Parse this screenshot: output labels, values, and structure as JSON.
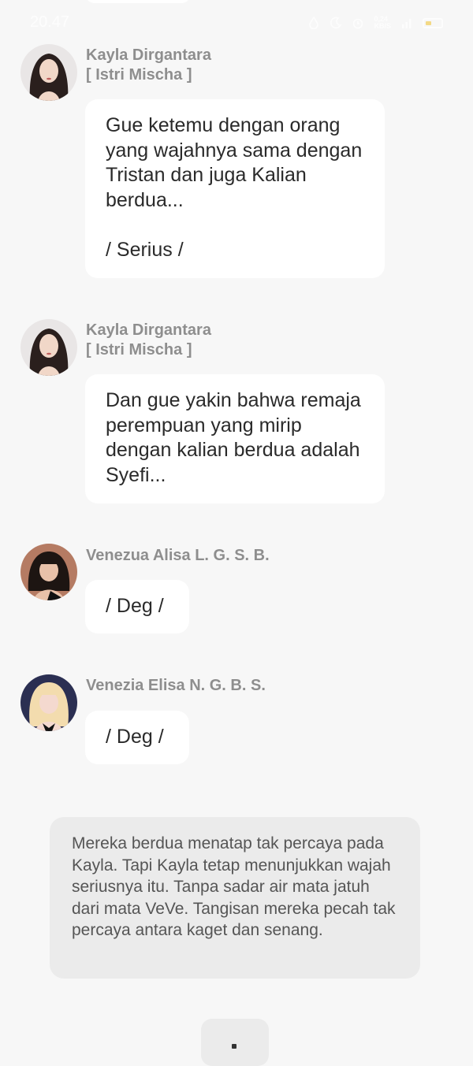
{
  "status_bar": {
    "time": "20.47",
    "network_speed": "0,24\nKB/S",
    "colors": {
      "battery_fill": "#f3d26b"
    }
  },
  "messages": [
    {
      "sender": "Kayla Dirgantara",
      "sender_sub": "[ Istri Mischa ]",
      "text": "Gue ketemu dengan orang yang wajahnya sama dengan Tristan dan juga Kalian berdua...\n\n/ Serius /"
    },
    {
      "sender": "Kayla Dirgantara",
      "sender_sub": "[ Istri Mischa ]",
      "text": "Dan gue yakin bahwa remaja perempuan yang mirip dengan kalian berdua adalah Syefi..."
    },
    {
      "sender": "Venezua Alisa L. G. S. B.",
      "text": "/ Deg /"
    },
    {
      "sender": "Venezia Elisa N. G. B. S.",
      "text": "/ Deg /"
    }
  ],
  "narration": {
    "text": "Mereka berdua menatap tak percaya pada Kayla. Tapi Kayla tetap menunjukkan wajah seriusnya itu. Tanpa sadar air mata jatuh dari mata VeVe. Tangisan mereka pecah tak percaya antara kaget dan senang."
  }
}
